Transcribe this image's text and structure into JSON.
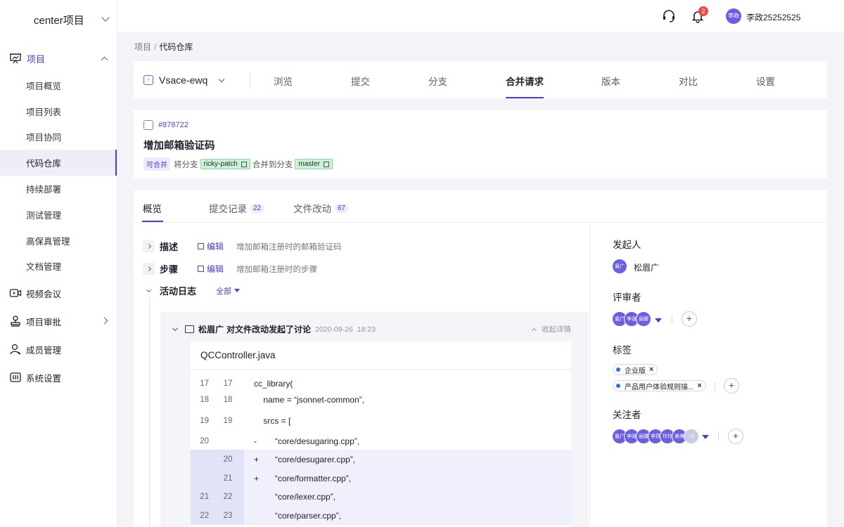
{
  "sidebar": {
    "project_name": "center项目",
    "group_project": "项目",
    "sub_items": [
      "项目概览",
      "项目列表",
      "项目协同",
      "代码仓库",
      "持续部署",
      "测试管理",
      "高保真管理",
      "文档管理"
    ],
    "video_meeting": "视频会议",
    "approval": "项目审批",
    "members": "成员管理",
    "settings": "系统设置"
  },
  "topbar": {
    "notification_count": "2",
    "user_avatar_text": "李政",
    "user_name": "李政25252525"
  },
  "breadcrumb": {
    "root": "项目",
    "sep": "/",
    "current": "代码仓库"
  },
  "repo": {
    "name": "Vsace-ewq",
    "tabs": [
      "浏览",
      "提交",
      "分支",
      "合并请求",
      "版本",
      "对比",
      "设置"
    ],
    "active_tab": "合并请求"
  },
  "mr": {
    "id": "#878722",
    "title": "增加邮箱验证码",
    "status": "可合并",
    "from_text": "将分支",
    "source_branch": "ricky-patch",
    "merge_text": "合并到分支",
    "target_branch": "master"
  },
  "detail_tabs": {
    "overview": "概览",
    "commits": "提交记录",
    "commits_count": "22",
    "files": "文件改动",
    "files_count": "67"
  },
  "sections": {
    "desc_label": "描述",
    "desc_edit": "编辑",
    "desc_text": "增加邮箱注册时的邮箱验证码",
    "steps_label": "步骤",
    "steps_edit": "编辑",
    "steps_text": "增加邮箱注册时的步骤",
    "log_label": "活动日志",
    "filter": "全部"
  },
  "activity": {
    "who": "松眉广",
    "action": "对文件改动发起了讨论",
    "date": "2020-09-26",
    "time": "18:23",
    "collapse": "收起详情",
    "file": "QCController.java",
    "lines": [
      {
        "old": "17",
        "new": "17",
        "sign": "",
        "text": "cc_library(",
        "type": "ctx"
      },
      {
        "old": "18",
        "new": "18",
        "sign": "",
        "text": "    name = “jsonnet-common”,",
        "type": "ctx"
      },
      {
        "old": "19",
        "new": "19",
        "sign": "",
        "text": "    srcs = [",
        "type": "ctx"
      },
      {
        "old": "20",
        "new": "",
        "sign": "-",
        "text": "         “core/desugaring.cpp”,",
        "type": "del"
      },
      {
        "old": "",
        "new": "20",
        "sign": "+",
        "text": "         “core/desugarer.cpp”,",
        "type": "add"
      },
      {
        "old": "",
        "new": "21",
        "sign": "+",
        "text": "         “core/formatter.cpp”,",
        "type": "add"
      },
      {
        "old": "21",
        "new": "22",
        "sign": "",
        "text": "         “core/lexer.cpp”,",
        "type": "add"
      },
      {
        "old": "22",
        "new": "23",
        "sign": "",
        "text": "         “core/parser.cpp”,",
        "type": "add"
      }
    ]
  },
  "side": {
    "initiator_title": "发起人",
    "initiator_avatar": "眉广",
    "initiator_name": "松眉广",
    "reviewers_title": "评审者",
    "reviewers": [
      "眉广",
      "李政",
      "丽娜"
    ],
    "labels_title": "标签",
    "labels": [
      "企业版",
      "产品用户体验规则描..."
    ],
    "watchers_title": "关注者",
    "watchers": [
      "眉广",
      "李政",
      "丽娜",
      "李燕",
      "玲玲",
      "美美",
      "+3"
    ]
  },
  "colors": {
    "accent": "#4b3fc8",
    "avatar": "#6b5ee0",
    "badge": "#f04a4a",
    "branch_tag": "#ccf0d8"
  }
}
